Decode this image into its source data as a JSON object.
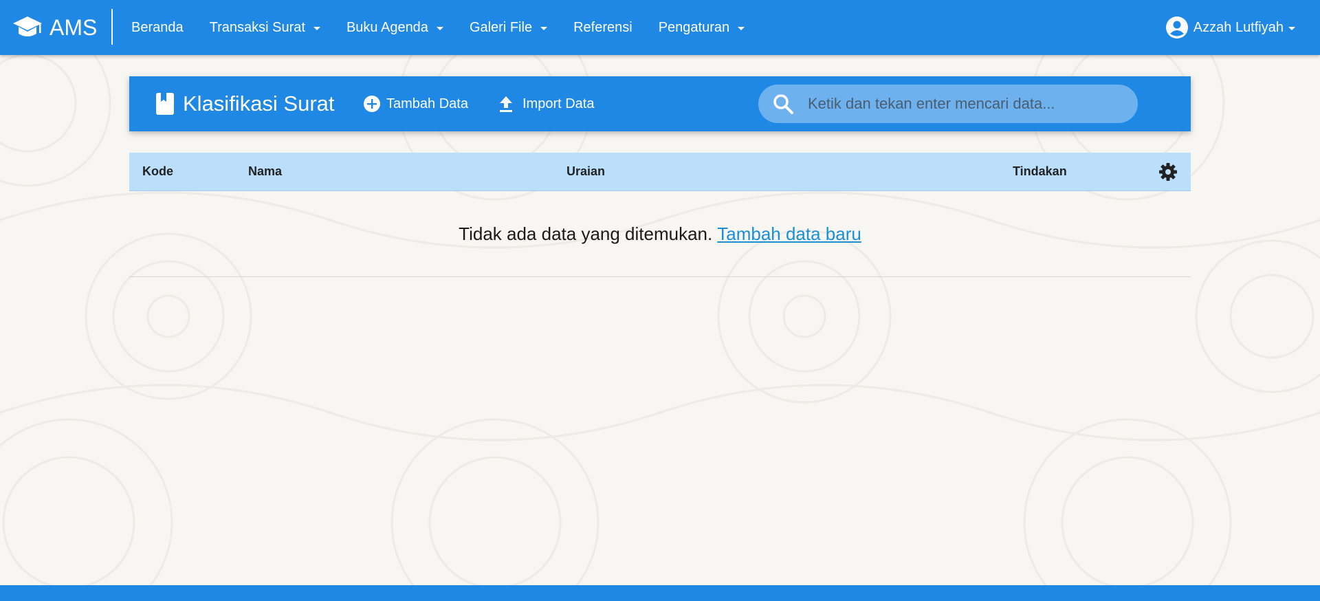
{
  "app": {
    "brand": "AMS",
    "brand_icon": "graduation-cap-icon",
    "accent_color": "#1f88e5",
    "table_header_color": "#bbdefb",
    "link_color": "#1a8fd8"
  },
  "nav": {
    "items": [
      {
        "label": "Beranda",
        "dropdown": false
      },
      {
        "label": "Transaksi Surat",
        "dropdown": true
      },
      {
        "label": "Buku Agenda",
        "dropdown": true
      },
      {
        "label": "Galeri File",
        "dropdown": true
      },
      {
        "label": "Referensi",
        "dropdown": false
      },
      {
        "label": "Pengaturan",
        "dropdown": true
      }
    ],
    "user": {
      "name": "Azzah Lutfiyah",
      "icon": "account-circle-icon"
    }
  },
  "page": {
    "title": "Klasifikasi Surat",
    "title_icon": "book-icon",
    "actions": {
      "add_label": "Tambah Data",
      "add_icon": "plus-circle-icon",
      "import_label": "Import Data",
      "import_icon": "upload-icon"
    },
    "search": {
      "placeholder": "Ketik dan tekan enter mencari data...",
      "value": "",
      "icon": "search-icon"
    }
  },
  "table": {
    "columns": [
      "Kode",
      "Nama",
      "Uraian",
      "Tindakan"
    ],
    "settings_icon": "gear-icon",
    "rows": [],
    "empty_text": "Tidak ada data yang ditemukan.",
    "empty_link": "Tambah data baru"
  }
}
